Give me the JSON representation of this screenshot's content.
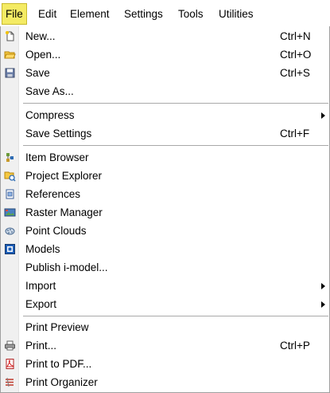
{
  "menubar": {
    "items": [
      {
        "label": "File",
        "id": "file"
      },
      {
        "label": "Edit",
        "id": "edit"
      },
      {
        "label": "Element",
        "id": "element"
      },
      {
        "label": "Settings",
        "id": "settings"
      },
      {
        "label": "Tools",
        "id": "tools"
      },
      {
        "label": "Utilities",
        "id": "utilities"
      }
    ]
  },
  "file_menu": {
    "new": {
      "label": "New...",
      "shortcut": "Ctrl+N",
      "icon": "new-document-icon"
    },
    "open": {
      "label": "Open...",
      "shortcut": "Ctrl+O",
      "icon": "open-folder-icon"
    },
    "save": {
      "label": "Save",
      "shortcut": "Ctrl+S",
      "icon": "save-disk-icon"
    },
    "save_as": {
      "label": "Save As..."
    },
    "compress": {
      "label": "Compress"
    },
    "save_settings": {
      "label": "Save Settings",
      "shortcut": "Ctrl+F"
    },
    "item_browser": {
      "label": "Item Browser",
      "icon": "item-browser-icon"
    },
    "project_explorer": {
      "label": "Project Explorer",
      "icon": "project-explorer-icon"
    },
    "references": {
      "label": "References",
      "icon": "references-icon"
    },
    "raster_manager": {
      "label": "Raster Manager",
      "icon": "raster-manager-icon"
    },
    "point_clouds": {
      "label": "Point Clouds",
      "icon": "point-clouds-icon"
    },
    "models": {
      "label": "Models",
      "icon": "models-icon"
    },
    "publish_imodel": {
      "label": "Publish i-model..."
    },
    "import": {
      "label": "Import"
    },
    "export": {
      "label": "Export"
    },
    "print_preview": {
      "label": "Print Preview"
    },
    "print": {
      "label": "Print...",
      "shortcut": "Ctrl+P",
      "icon": "printer-icon"
    },
    "print_to_pdf": {
      "label": "Print to PDF...",
      "icon": "pdf-icon"
    },
    "print_organizer": {
      "label": "Print Organizer",
      "icon": "print-organizer-icon"
    }
  },
  "colors": {
    "active_menu_bg": "#f4eb64",
    "active_menu_border": "#c7b92c",
    "gutter": "#f0f0f0",
    "separator": "#a9a9a9"
  }
}
